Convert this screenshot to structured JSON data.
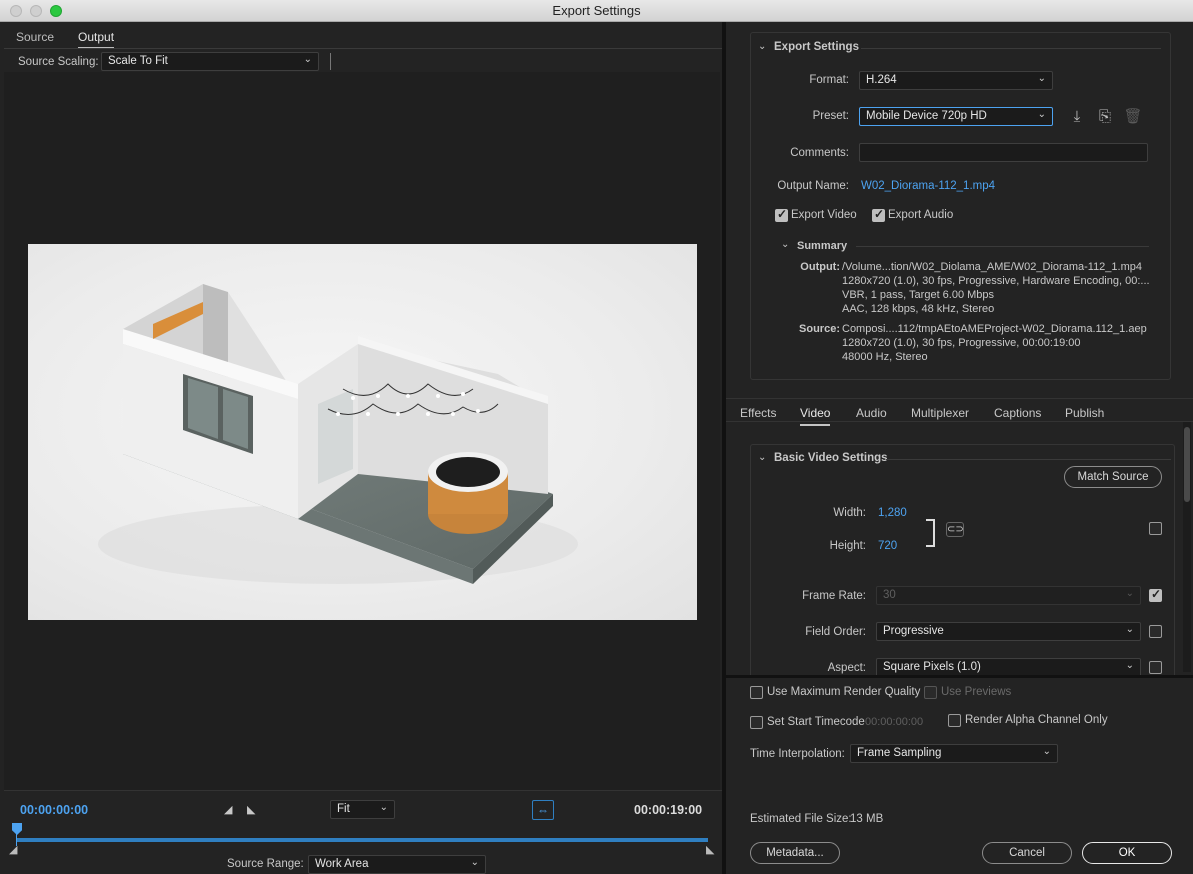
{
  "window": {
    "title": "Export Settings"
  },
  "left": {
    "tabs": [
      {
        "label": "Source"
      },
      {
        "label": "Output"
      }
    ],
    "source_scaling": {
      "label": "Source Scaling:",
      "value": "Scale To Fit"
    },
    "timeline": {
      "current_time": "00:00:00:00",
      "duration": "00:00:19:00",
      "zoom": "Fit",
      "source_range_label": "Source Range:",
      "source_range_value": "Work Area",
      "playhead_position": 0.0
    }
  },
  "export_settings": {
    "header": "Export Settings",
    "format_label": "Format:",
    "format_value": "H.264",
    "preset_label": "Preset:",
    "preset_value": "Mobile Device 720p HD",
    "comments_label": "Comments:",
    "comments_value": "",
    "output_name_label": "Output Name:",
    "output_name_value": "W02_Diorama-112_1.mp4",
    "export_video_label": "Export Video",
    "export_video_checked": true,
    "export_audio_label": "Export Audio",
    "export_audio_checked": true,
    "icons": [
      "save-preset-icon",
      "import-preset-icon",
      "delete-preset-icon"
    ]
  },
  "summary": {
    "header": "Summary",
    "output_label": "Output:",
    "output_lines": [
      "/Volume...tion/W02_Diolama_AME/W02_Diorama-112_1.mp4",
      "1280x720 (1.0), 30 fps, Progressive, Hardware Encoding, 00:...",
      "VBR, 1 pass, Target 6.00 Mbps",
      "AAC, 128 kbps, 48 kHz, Stereo"
    ],
    "source_label": "Source:",
    "source_lines": [
      "Composi....112/tmpAEtoAMEProject-W02_Diorama.112_1.aep",
      "1280x720 (1.0), 30 fps, Progressive, 00:00:19:00",
      "48000 Hz, Stereo"
    ]
  },
  "settings_tabs": [
    {
      "label": "Effects"
    },
    {
      "label": "Video"
    },
    {
      "label": "Audio"
    },
    {
      "label": "Multiplexer"
    },
    {
      "label": "Captions"
    },
    {
      "label": "Publish"
    }
  ],
  "basic_video": {
    "header": "Basic Video Settings",
    "match_source": "Match Source",
    "width_label": "Width:",
    "width_value": "1,280",
    "height_label": "Height:",
    "height_value": "720",
    "frame_rate_label": "Frame Rate:",
    "frame_rate_value": "30",
    "field_order_label": "Field Order:",
    "field_order_value": "Progressive",
    "aspect_label": "Aspect:",
    "aspect_value": "Square Pixels (1.0)"
  },
  "bottom": {
    "max_render_quality": "Use Maximum Render Quality",
    "use_previews": "Use Previews",
    "set_start_timecode": "Set Start Timecode",
    "start_timecode_value": "00:00:00:00",
    "render_alpha": "Render Alpha Channel Only",
    "time_interp_label": "Time Interpolation:",
    "time_interp_value": "Frame Sampling",
    "file_size_label": "Estimated File Size:",
    "file_size_value": "13 MB",
    "metadata_button": "Metadata...",
    "cancel_button": "Cancel",
    "ok_button": "OK"
  },
  "colors": {
    "accent": "#4da3f1",
    "background": "#232323"
  }
}
